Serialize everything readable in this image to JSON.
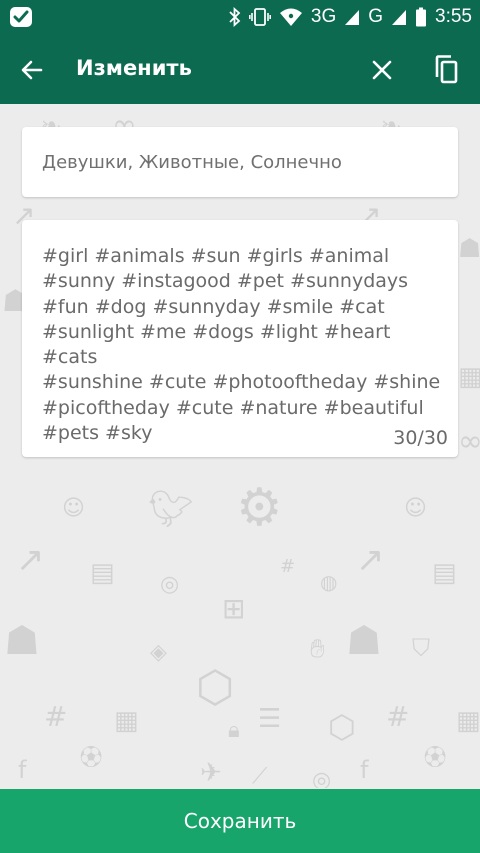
{
  "status_bar": {
    "network_3g": "3G",
    "network_g": "G",
    "time": "3:55",
    "icons": [
      "bluetooth-icon",
      "vibrate-icon",
      "wifi-icon",
      "signal-icon",
      "battery-icon"
    ]
  },
  "app_bar": {
    "title": "Изменить",
    "icons": [
      "back-arrow-icon",
      "close-icon",
      "copy-icon"
    ]
  },
  "form": {
    "title_value": "Девушки, Животные, Солнечно",
    "tags_value": "#girl #animals #sun #girls #animal\n#sunny #instagood #pet #sunnydays\n#fun #dog #sunnyday #smile #cat\n#sunlight #me #dogs #light #heart #cats\n#sunshine #cute #photooftheday #shine\n#picoftheday #cute #nature #beautiful\n#pets #sky",
    "tags_count": "30/30"
  },
  "save_button": {
    "label": "Сохранить"
  },
  "colors": {
    "app_bar": "#0b6a4f",
    "save_bar": "#17a56b",
    "background": "#ececec",
    "pattern": "#d2d2d2"
  }
}
